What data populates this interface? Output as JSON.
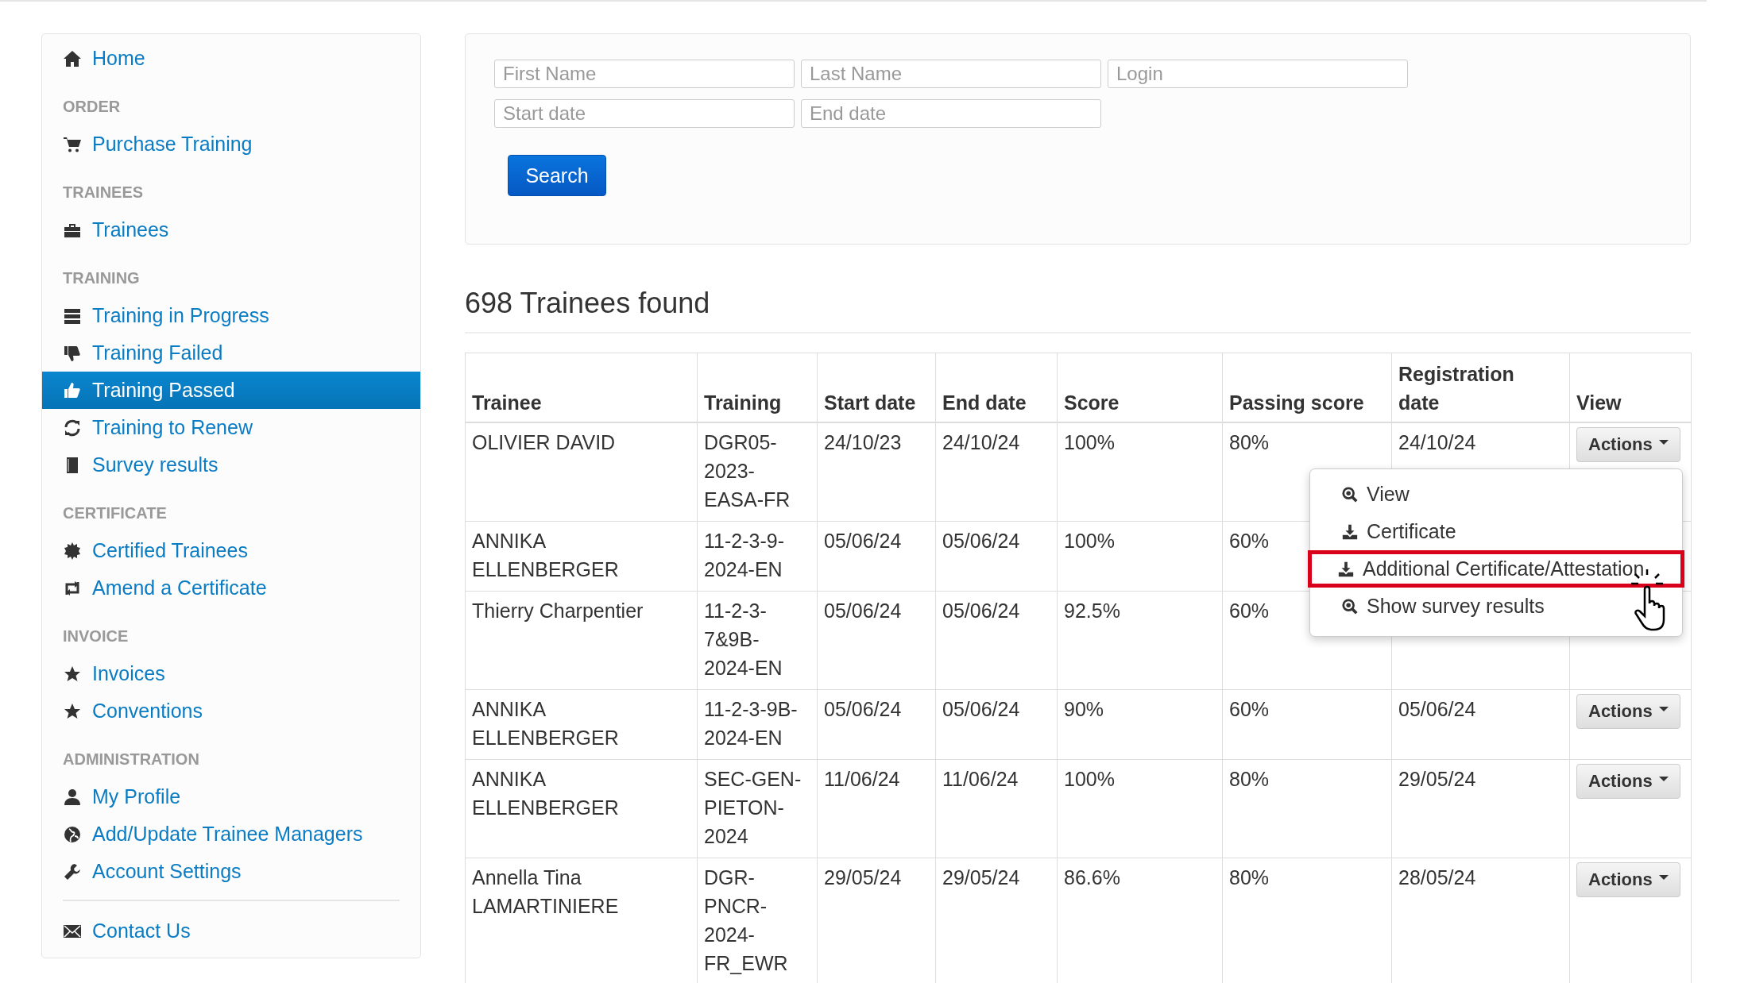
{
  "sidebar": {
    "groups": [
      {
        "items": [
          {
            "label": "Home",
            "selected": false
          }
        ]
      },
      {
        "heading": "ORDER",
        "items": [
          {
            "label": "Purchase Training",
            "selected": false
          }
        ]
      },
      {
        "heading": "TRAINEES",
        "items": [
          {
            "label": "Trainees",
            "selected": false
          }
        ]
      },
      {
        "heading": "TRAINING",
        "items": [
          {
            "label": "Training in Progress",
            "selected": false
          },
          {
            "label": "Training Failed",
            "selected": false
          },
          {
            "label": "Training Passed",
            "selected": true
          },
          {
            "label": "Training to Renew",
            "selected": false
          },
          {
            "label": "Survey results",
            "selected": false
          }
        ]
      },
      {
        "heading": "CERTIFICATE",
        "items": [
          {
            "label": "Certified Trainees",
            "selected": false
          },
          {
            "label": "Amend a Certificate",
            "selected": false
          }
        ]
      },
      {
        "heading": "INVOICE",
        "items": [
          {
            "label": "Invoices",
            "selected": false
          },
          {
            "label": "Conventions",
            "selected": false
          }
        ]
      },
      {
        "heading": "ADMINISTRATION",
        "items": [
          {
            "label": "My Profile",
            "selected": false
          },
          {
            "label": "Add/Update Trainee Managers",
            "selected": false
          },
          {
            "label": "Account Settings",
            "selected": false
          }
        ]
      },
      {
        "items": [
          {
            "label": "Contact Us",
            "selected": false
          }
        ]
      }
    ]
  },
  "search_form": {
    "fields": [
      {
        "placeholder": "First Name"
      },
      {
        "placeholder": "Last Name"
      },
      {
        "placeholder": "Login"
      },
      {
        "placeholder": "Start date"
      },
      {
        "placeholder": "End date"
      }
    ],
    "button": "Search"
  },
  "results_heading": "698 Trainees found",
  "table": {
    "columns": [
      "Trainee",
      "Training",
      "Start date",
      "End date",
      "Score",
      "Passing score",
      "Registration date",
      "View"
    ],
    "rows": [
      {
        "cells": [
          "OLIVIER DAVID",
          "DGR05-\n2023-\nEASA-FR",
          "24/10/23",
          "24/10/24",
          "100%",
          "80%",
          "24/10/24"
        ],
        "action": "Actions"
      },
      {
        "cells": [
          "ANNIKA\nELLENBERGER",
          "11-2-3-9-\n2024-EN",
          "05/06/24",
          "05/06/24",
          "100%",
          "60%"
        ]
      },
      {
        "cells": [
          "Thierry Charpentier",
          "11-2-3-\n7&9B-\n2024-EN",
          "05/06/24",
          "05/06/24",
          "92.5%",
          "60%"
        ]
      },
      {
        "cells": [
          "ANNIKA\nELLENBERGER",
          "11-2-3-9B-\n2024-EN",
          "05/06/24",
          "05/06/24",
          "90%",
          "60%",
          "05/06/24"
        ],
        "action": "Actions"
      },
      {
        "cells": [
          "ANNIKA\nELLENBERGER",
          "SEC-GEN-\nPIETON-\n2024",
          "11/06/24",
          "11/06/24",
          "100%",
          "80%",
          "29/05/24"
        ],
        "action": "Actions"
      },
      {
        "cells": [
          "Annella Tina\nLAMARTINIERE",
          "DGR-\nPNCR-\n2024-\nFR_EWR",
          "29/05/24",
          "29/05/24",
          "86.6%",
          "80%",
          "28/05/24"
        ],
        "action": "Actions"
      }
    ]
  },
  "actions_menu": {
    "items": [
      {
        "label": "View",
        "highlighted": false
      },
      {
        "label": "Certificate",
        "highlighted": false
      },
      {
        "label": "Additional Certificate/Attestation",
        "highlighted": true
      },
      {
        "label": "Show survey results",
        "highlighted": false
      }
    ]
  }
}
